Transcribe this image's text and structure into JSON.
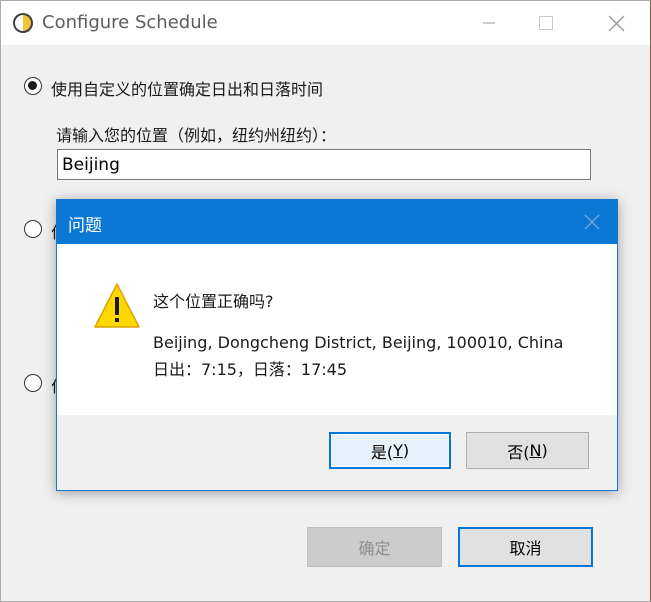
{
  "window": {
    "title": "Configure Schedule",
    "app_icon": "half-sun-icon",
    "controls": [
      "minimize-icon",
      "maximize-icon",
      "close-icon"
    ]
  },
  "options": {
    "custom_location_label": "使用自定义的位置确定日出和日落时间",
    "custom_location_selected": true,
    "location_prompt": "请输入您的位置（例如，纽约州纽约）：",
    "location_value": "Beijing",
    "hidden_option_2_partial": "位",
    "hidden_option_3_partial": "位"
  },
  "footer": {
    "ok_label": "确定",
    "cancel_label": "取消"
  },
  "dialog": {
    "title": "问题",
    "icon": "warning-icon",
    "question": "这个位置正确吗?",
    "address": "Beijing, Dongcheng District, Beijing, 100010, China",
    "times": "日出：7:15，日落：17:45",
    "yes_label": "是(",
    "yes_key": "Y",
    "yes_end": ")",
    "no_label": "否(",
    "no_key": "N",
    "no_end": ")"
  },
  "colors": {
    "dialog_title_bg": "#0a78d4",
    "accent_border": "#0078d7",
    "window_bg": "#f0f0f0",
    "warning_fill": "#ffd800"
  }
}
